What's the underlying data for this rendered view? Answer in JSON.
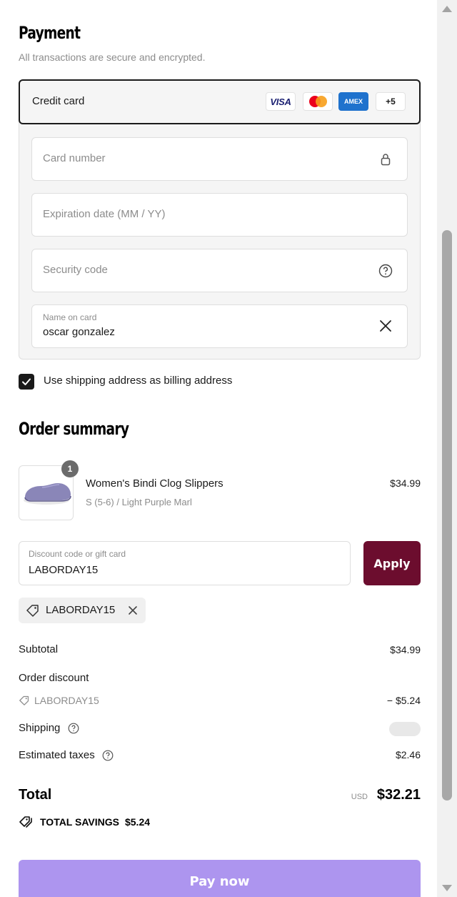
{
  "payment": {
    "title": "Payment",
    "subtitle": "All transactions are secure and encrypted.",
    "method_label": "Credit card",
    "card_brands": [
      "VISA",
      "Mastercard",
      "AMEX",
      "+5"
    ],
    "fields": {
      "card_number_placeholder": "Card number",
      "expiration_placeholder": "Expiration date (MM / YY)",
      "security_code_placeholder": "Security code",
      "name_label": "Name on card",
      "name_value": "oscar gonzalez"
    },
    "billing_checkbox_label": "Use shipping address as billing address",
    "billing_checked": true
  },
  "order_summary": {
    "title": "Order summary",
    "item": {
      "quantity": "1",
      "name": "Women's Bindi Clog Slippers",
      "variant": "S (5-6) / Light Purple Marl",
      "price": "$34.99"
    },
    "discount": {
      "label": "Discount code or gift card",
      "value": "LABORDAY15",
      "apply_label": "Apply",
      "applied_tag": "LABORDAY15"
    },
    "lines": {
      "subtotal_label": "Subtotal",
      "subtotal_value": "$34.99",
      "order_discount_label": "Order discount",
      "discount_code": "LABORDAY15",
      "discount_value": "− $5.24",
      "shipping_label": "Shipping",
      "taxes_label": "Estimated taxes",
      "taxes_value": "$2.46"
    },
    "total": {
      "label": "Total",
      "currency": "USD",
      "amount": "$32.21"
    },
    "savings": {
      "label": "TOTAL SAVINGS",
      "amount": "$5.24"
    },
    "pay_label": "Pay now"
  },
  "colors": {
    "apply_button": "#6c0d2e",
    "pay_button": "#ad95ef",
    "slipper": "#8a86b8"
  }
}
